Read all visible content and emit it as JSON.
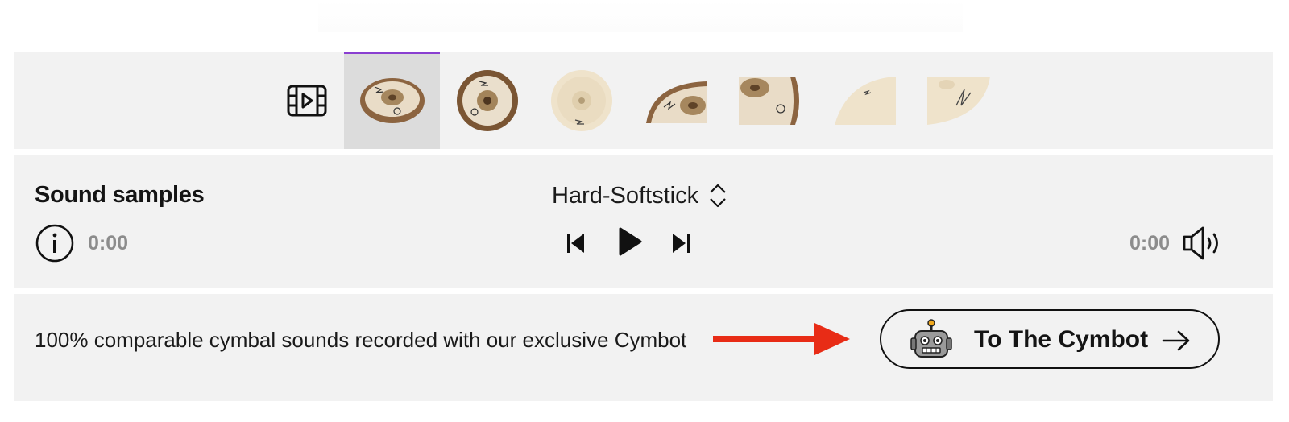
{
  "gallery": {
    "video_icon": "video-play-icon",
    "thumbnails": [
      {
        "view": "front angled",
        "active": true
      },
      {
        "view": "top"
      },
      {
        "view": "bottom"
      },
      {
        "view": "edge"
      },
      {
        "view": "bell detail"
      },
      {
        "view": "surface"
      },
      {
        "view": "logo"
      }
    ],
    "accent_color": "#8a3fd1"
  },
  "player": {
    "title": "Sound samples",
    "stick_selected": "Hard-Softstick",
    "select_icon": "chevron-updown-icon",
    "info_icon": "info-icon",
    "time_current": "0:00",
    "time_total": "0:00",
    "controls": {
      "prev_icon": "skip-back-icon",
      "play_icon": "play-icon",
      "next_icon": "skip-forward-icon",
      "volume_icon": "volume-icon"
    }
  },
  "cymbot": {
    "promo_text": "100% comparable cymbal sounds recorded with our exclusive Cymbot",
    "arrow_color": "#e82c16",
    "button_label": "To The Cymbot",
    "robot_icon": "robot-icon",
    "go_icon": "arrow-right-icon"
  }
}
